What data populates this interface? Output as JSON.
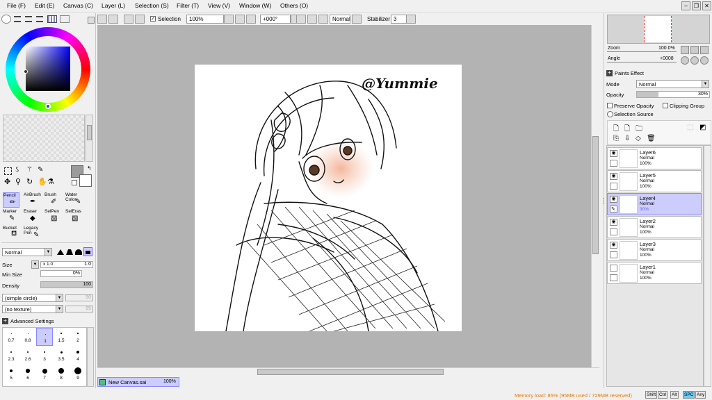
{
  "menu": {
    "items": [
      "File (F)",
      "Edit (E)",
      "Canvas (C)",
      "Layer (L)",
      "Selection (S)",
      "Filter (T)",
      "View (V)",
      "Window (W)",
      "Others (O)"
    ]
  },
  "window_buttons": {
    "minimize": "–",
    "restore": "❐",
    "close": "✕"
  },
  "toolbar": {
    "selection_label": "Selection",
    "zoom_value": "100%",
    "angle_value": "+000°",
    "blend_mode": "Normal",
    "stabilizer_label": "Stabilizer",
    "stabilizer_value": "3"
  },
  "tools": {
    "pencil": "Pencil",
    "airbrush": "AirBrush",
    "brush": "Brush",
    "water": "Water Color",
    "marker": "Marker",
    "eraser": "Eraser",
    "selpen": "SelPen",
    "seleras": "SelEras",
    "bucket": "Bucket",
    "legacy": "Legacy Pen"
  },
  "brush_settings": {
    "mode": "Normal",
    "size_label": "Size",
    "size_mult": "x 1.0",
    "size_value": "1.0",
    "min_size_label": "Min Size",
    "min_size_value": "0%",
    "density_label": "Density",
    "density_value": "100",
    "shape": "(simple circle)",
    "shape_value": "50",
    "texture": "(no texture)",
    "texture_value": "95",
    "advanced": "Advanced Settings"
  },
  "brush_sizes": [
    "0.7",
    "0.8",
    "1",
    "1.5",
    "2",
    "2.3",
    "2.6",
    "3",
    "3.5",
    "4",
    "5",
    "6",
    "7",
    "8",
    "9"
  ],
  "canvas": {
    "watermark": "@Yummie",
    "tab_name": "New Canvas.sai",
    "tab_zoom": "100%"
  },
  "navigator": {
    "zoom_label": "Zoom",
    "zoom_value": "100.0%",
    "angle_label": "Angle",
    "angle_value": "+0008"
  },
  "layer_props": {
    "paints_effect": "Paints Effect",
    "mode_label": "Mode",
    "mode_value": "Normal",
    "opacity_label": "Opacity",
    "opacity_value": "30%",
    "preserve_opacity": "Preserve Opacity",
    "clipping_group": "Clipping Group",
    "selection_source": "Selection Source"
  },
  "layers": [
    {
      "name": "Layer6",
      "mode": "Normal",
      "opacity": "100%",
      "selected": false,
      "visible": true
    },
    {
      "name": "Layer5",
      "mode": "Normal",
      "opacity": "100%",
      "selected": false,
      "visible": true
    },
    {
      "name": "Layer4",
      "mode": "Normal",
      "opacity": "30%",
      "selected": true,
      "visible": true
    },
    {
      "name": "Layer2",
      "mode": "Normal",
      "opacity": "100%",
      "selected": false,
      "visible": true
    },
    {
      "name": "Layer3",
      "mode": "Normal",
      "opacity": "100%",
      "selected": false,
      "visible": true
    },
    {
      "name": "Layer1",
      "mode": "Normal",
      "opacity": "100%",
      "selected": false,
      "visible": false
    }
  ],
  "status": {
    "memory": "Memory load: 85% (95MB used / 729MB reserved)",
    "keys": [
      "Shift",
      "Ctrl",
      "Alt",
      "SPC",
      "Any"
    ]
  },
  "colors": {
    "accent": "#ccccff",
    "canvas_bg": "#b3b3b3",
    "status_text": "#e87a00"
  }
}
